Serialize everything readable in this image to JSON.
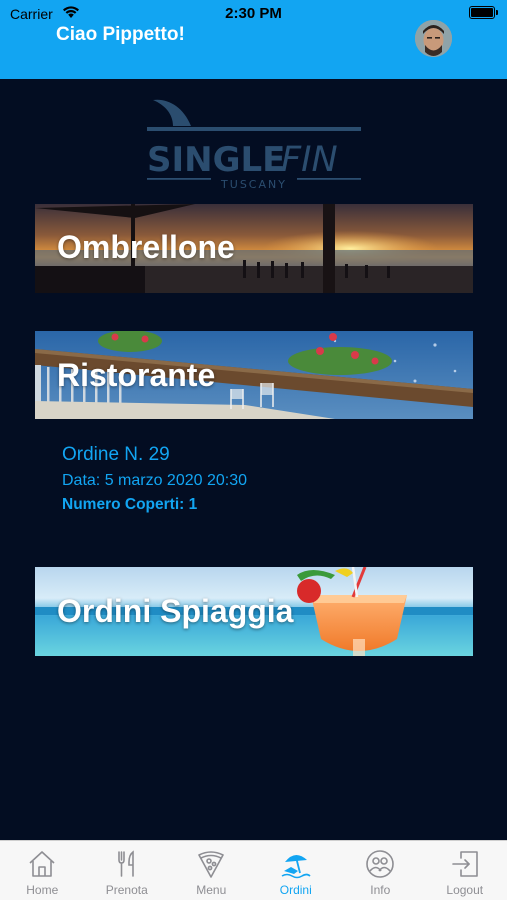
{
  "status_bar": {
    "carrier": "Carrier",
    "time": "2:30 PM"
  },
  "header": {
    "greeting": "Ciao Pippetto!"
  },
  "logo": {
    "word_left": "SINGLE",
    "word_right": "FIN",
    "subtitle": "TUSCANY"
  },
  "cards": [
    {
      "id": "ombrellone",
      "label": "Ombrellone"
    },
    {
      "id": "ristorante",
      "label": "Ristorante"
    },
    {
      "id": "ordini-spiaggia",
      "label": "Ordini Spiaggia"
    }
  ],
  "order": {
    "number": "Ordine N. 29",
    "date": "Data: 5 marzo 2020 20:30",
    "covers": "Numero Coperti: 1"
  },
  "tabs": [
    {
      "label": "Home",
      "icon": "home-icon",
      "active": false
    },
    {
      "label": "Prenota",
      "icon": "fork-knife-icon",
      "active": false
    },
    {
      "label": "Menu",
      "icon": "pizza-icon",
      "active": false
    },
    {
      "label": "Ordini",
      "icon": "beach-umbrella-icon",
      "active": true
    },
    {
      "label": "Info",
      "icon": "people-icon",
      "active": false
    },
    {
      "label": "Logout",
      "icon": "logout-icon",
      "active": false
    }
  ],
  "colors": {
    "accent": "#12a5f2",
    "background": "#030d22",
    "logo": "#2b4d6f",
    "tab_inactive": "#8e8e93"
  }
}
